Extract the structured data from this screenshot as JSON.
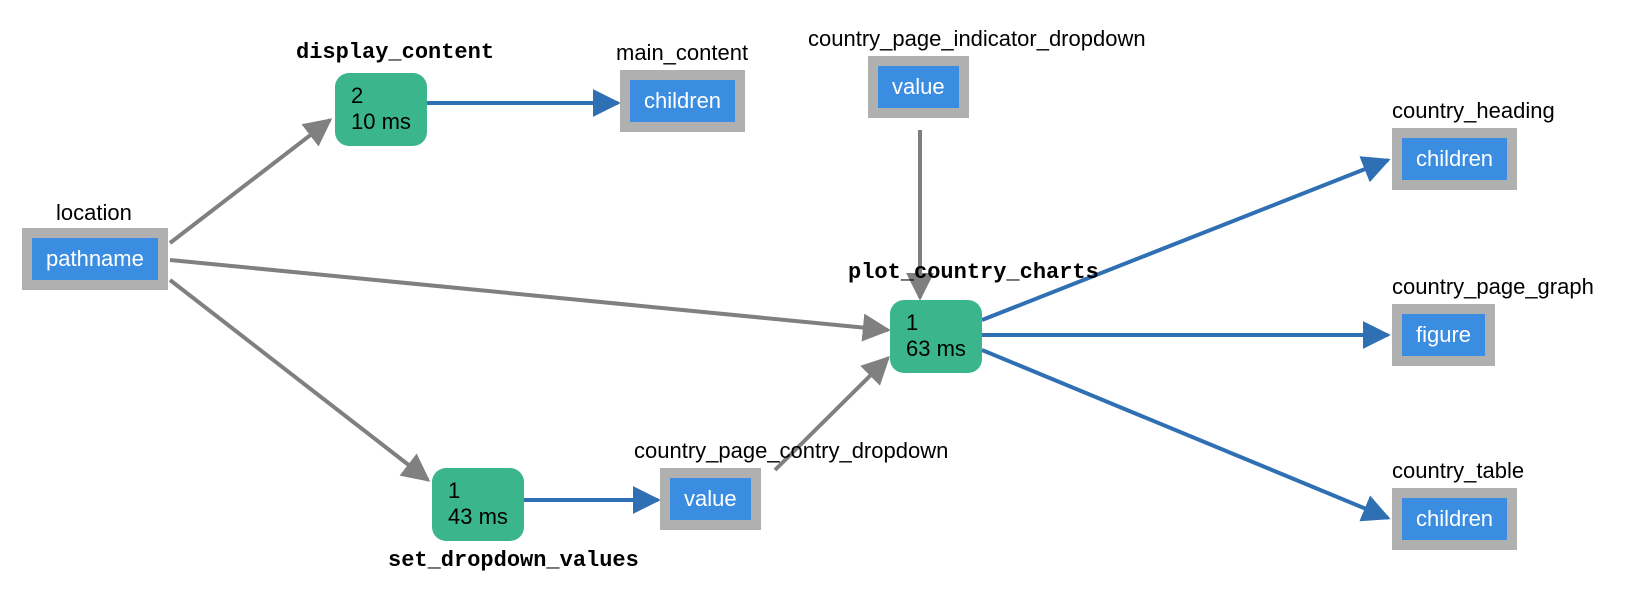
{
  "nodes": {
    "location": {
      "title": "location",
      "prop": "pathname"
    },
    "main_content": {
      "title": "main_content",
      "prop": "children"
    },
    "indicator_dropdown": {
      "title": "country_page_indicator_dropdown",
      "prop": "value"
    },
    "country_dropdown": {
      "title": "country_page_contry_dropdown",
      "prop": "value"
    },
    "country_heading": {
      "title": "country_heading",
      "prop": "children"
    },
    "country_graph": {
      "title": "country_page_graph",
      "prop": "figure"
    },
    "country_table": {
      "title": "country_table",
      "prop": "children"
    }
  },
  "callbacks": {
    "display_content": {
      "title": "display_content",
      "count": "2",
      "time": "10 ms"
    },
    "set_dropdown_values": {
      "title": "set_dropdown_values",
      "count": "1",
      "time": "43 ms"
    },
    "plot_country_charts": {
      "title": "plot_country_charts",
      "count": "1",
      "time": "63 ms"
    }
  },
  "colors": {
    "callback_box": "#3bb58b",
    "prop_outer": "#b0b0b0",
    "prop_inner": "#3a8de0",
    "arrow_grey": "#808080",
    "arrow_blue": "#2f6fb3"
  }
}
